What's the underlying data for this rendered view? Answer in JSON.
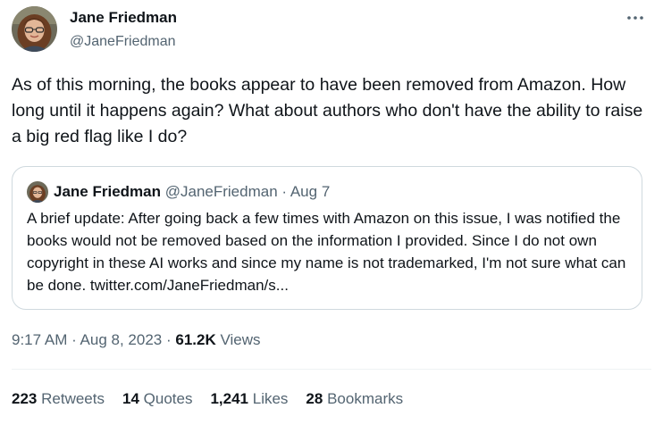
{
  "tweet": {
    "author_name": "Jane Friedman",
    "author_handle": "@JaneFriedman",
    "more_icon": "more-horizontal-icon",
    "text": "As of this morning, the books appear to have been removed from Amazon. How long until it happens again? What about authors who don't have the ability to raise a big red flag like I do?"
  },
  "quote": {
    "author_name": "Jane Friedman",
    "author_handle": "@JaneFriedman",
    "separator": " · ",
    "date": "Aug 7",
    "text": "A brief update: After going back a few times with Amazon on this issue, I was notified the books would not be removed based on the information I provided. Since I do not own  copyright in these AI works and since my name is not trademarked, I'm not sure what can be done. twitter.com/JaneFriedman/s..."
  },
  "meta": {
    "time": "9:17 AM",
    "sep1": " · ",
    "date": "Aug 8, 2023",
    "sep2": " · ",
    "views_count": "61.2K",
    "views_label": " Views"
  },
  "stats": {
    "retweets_count": "223",
    "retweets_label": "Retweets",
    "quotes_count": "14",
    "quotes_label": "Quotes",
    "likes_count": "1,241",
    "likes_label": "Likes",
    "bookmarks_count": "28",
    "bookmarks_label": "Bookmarks"
  },
  "colors": {
    "primary_text": "#0f1419",
    "secondary_text": "#536471",
    "border": "#cfd9de"
  }
}
